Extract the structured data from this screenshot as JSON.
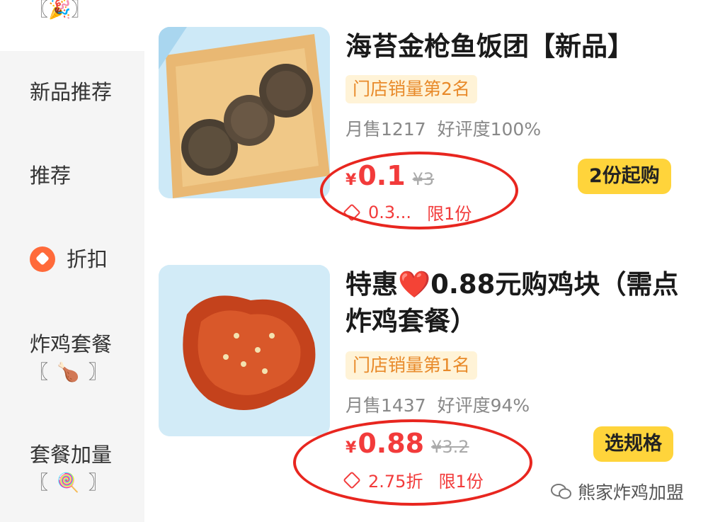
{
  "sidebar": {
    "top_partial": "〖🎉〗",
    "items": [
      {
        "label": "新品推荐",
        "sub": ""
      },
      {
        "label": "推荐",
        "sub": ""
      },
      {
        "label": "折扣",
        "sub": ""
      },
      {
        "label": "炸鸡套餐",
        "sub": "〖 🍗 〗"
      },
      {
        "label": "套餐加量",
        "sub": "〖 🍭 〗"
      }
    ]
  },
  "products": [
    {
      "title": "海苔金枪鱼饭团【新品】",
      "rank": "门店销量第2名",
      "monthly_sales": "月售1217",
      "rating": "好评度100%",
      "currency": "¥",
      "price": "0.1",
      "original_price": "¥3",
      "discount": "0.3...",
      "limit": "限1份",
      "action": "2份起购"
    },
    {
      "title": "特惠❤️0.88元购鸡块（需点炸鸡套餐）",
      "rank": "门店销量第1名",
      "monthly_sales": "月售1437",
      "rating": "好评度94%",
      "currency": "¥",
      "price": "0.88",
      "original_price": "¥3.2",
      "discount": "2.75折",
      "limit": "限1份",
      "action": "选规格"
    }
  ],
  "watermark": "熊家炸鸡加盟",
  "colors": {
    "price_red": "#f23b3b",
    "annotation_red": "#e8261f",
    "button_yellow": "#ffd43b",
    "rank_bg": "#fff3d7",
    "rank_text": "#e88a2a",
    "sidebar_bg": "#f5f5f5"
  }
}
